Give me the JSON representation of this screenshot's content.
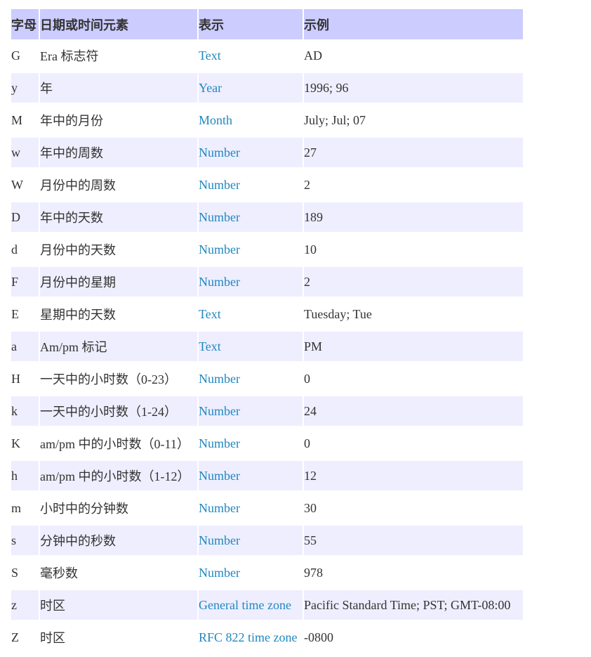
{
  "headers": [
    "字母",
    "日期或时间元素",
    "表示",
    "示例"
  ],
  "rows": [
    {
      "letter": "G",
      "element": "Era 标志符",
      "presentation": "Text",
      "example": "AD"
    },
    {
      "letter": "y",
      "element": "年",
      "presentation": "Year",
      "example": "1996; 96"
    },
    {
      "letter": "M",
      "element": "年中的月份",
      "presentation": "Month",
      "example": "July; Jul; 07"
    },
    {
      "letter": "w",
      "element": "年中的周数",
      "presentation": "Number",
      "example": "27"
    },
    {
      "letter": "W",
      "element": "月份中的周数",
      "presentation": "Number",
      "example": "2"
    },
    {
      "letter": "D",
      "element": "年中的天数",
      "presentation": "Number",
      "example": "189"
    },
    {
      "letter": "d",
      "element": "月份中的天数",
      "presentation": "Number",
      "example": "10"
    },
    {
      "letter": "F",
      "element": "月份中的星期",
      "presentation": "Number",
      "example": "2"
    },
    {
      "letter": "E",
      "element": "星期中的天数",
      "presentation": "Text",
      "example": "Tuesday; Tue"
    },
    {
      "letter": "a",
      "element": "Am/pm 标记",
      "presentation": "Text",
      "example": "PM"
    },
    {
      "letter": "H",
      "element": "一天中的小时数（0-23）",
      "presentation": "Number",
      "example": "0"
    },
    {
      "letter": "k",
      "element": "一天中的小时数（1-24）",
      "presentation": "Number",
      "example": "24"
    },
    {
      "letter": "K",
      "element": "am/pm 中的小时数（0-11）",
      "presentation": "Number",
      "example": "0"
    },
    {
      "letter": "h",
      "element": "am/pm 中的小时数（1-12）",
      "presentation": "Number",
      "example": "12"
    },
    {
      "letter": "m",
      "element": "小时中的分钟数",
      "presentation": "Number",
      "example": "30"
    },
    {
      "letter": "s",
      "element": "分钟中的秒数",
      "presentation": "Number",
      "example": "55"
    },
    {
      "letter": "S",
      "element": "毫秒数",
      "presentation": "Number",
      "example": "978"
    },
    {
      "letter": "z",
      "element": "时区",
      "presentation": "General time zone",
      "example": "Pacific Standard Time; PST; GMT-08:00"
    },
    {
      "letter": "Z",
      "element": "时区",
      "presentation": "RFC 822 time zone",
      "example": "-0800"
    }
  ]
}
